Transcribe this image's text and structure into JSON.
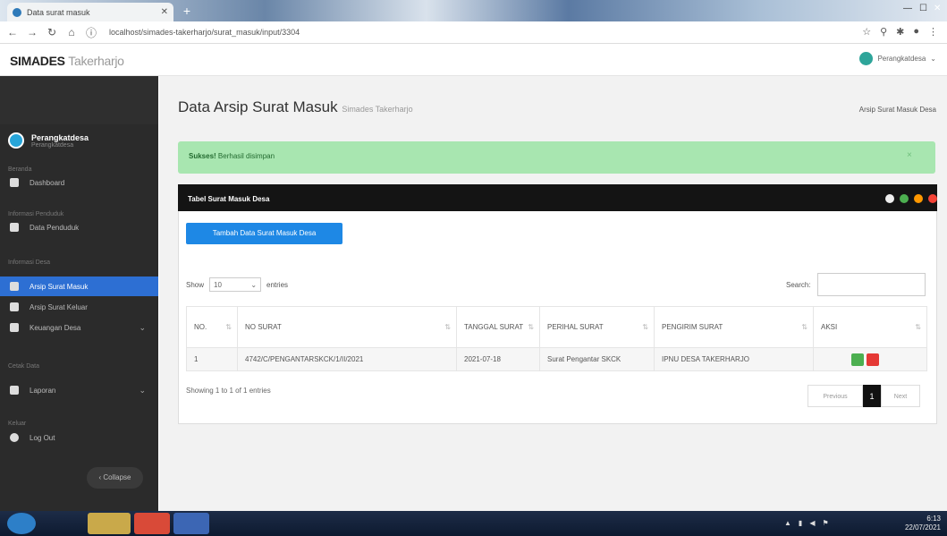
{
  "browser": {
    "tab_title": "Data surat masuk",
    "url": "localhost/simades-takerharjo/surat_masuk/input/3304"
  },
  "app": {
    "brand": "SIMADES",
    "brand_light": "Takerharjo",
    "user_name": "Perangkatdesa"
  },
  "sidebar": {
    "user": {
      "name": "Perangkatdesa",
      "role": "Perangkatdesa"
    },
    "headers": {
      "h1": "Beranda",
      "h2": "Informasi Penduduk",
      "h3": "Informasi Desa",
      "h4": "Cetak Data",
      "h5": "Keluar"
    },
    "items": [
      {
        "label": "Dashboard"
      },
      {
        "label": "Data Penduduk"
      },
      {
        "label": "Arsip Surat Masuk"
      },
      {
        "label": "Arsip Surat Keluar"
      },
      {
        "label": "Keuangan Desa"
      },
      {
        "label": "Laporan"
      },
      {
        "label": "Log Out"
      }
    ],
    "collapse_label": "Collapse"
  },
  "main": {
    "title": "Data Arsip Surat Masuk",
    "subtitle": "Simades Takerharjo",
    "breadcrumb": "Arsip Surat Masuk Desa",
    "alert_strong": "Sukses!",
    "alert_text": "Berhasil disimpan",
    "alert_close": "×",
    "panel_title": "Tabel Surat Masuk Desa",
    "add_button": "Tambah Data Surat Masuk Desa",
    "show_label": "Show",
    "show_value": "10",
    "entries_label": "entries",
    "search_label": "Search:",
    "table": {
      "headers": [
        "NO.",
        "NO SURAT",
        "TANGGAL SURAT",
        "PERIHAL SURAT",
        "PENGIRIM SURAT",
        "AKSI"
      ],
      "rows": [
        [
          "1",
          "4742/C/PENGANTARSKCK/1/II/2021",
          "2021-07-18",
          "Surat Pengantar SKCK",
          "IPNU DESA TAKERHARJO"
        ]
      ]
    },
    "info": "Showing 1 to 1 of 1 entries",
    "pager": {
      "prev": "Previous",
      "current": "1",
      "next": "Next"
    }
  },
  "colors": {
    "sidebar_bg": "#2b2b2b",
    "active_item": "#2d6fd3",
    "alert_bg": "#a8e6b0",
    "primary_button": "#1e88e5",
    "edit_button": "#4caf50",
    "delete_button": "#e53935"
  },
  "taskbar": {
    "clock_time": "6:13",
    "clock_date": "22/07/2021"
  }
}
